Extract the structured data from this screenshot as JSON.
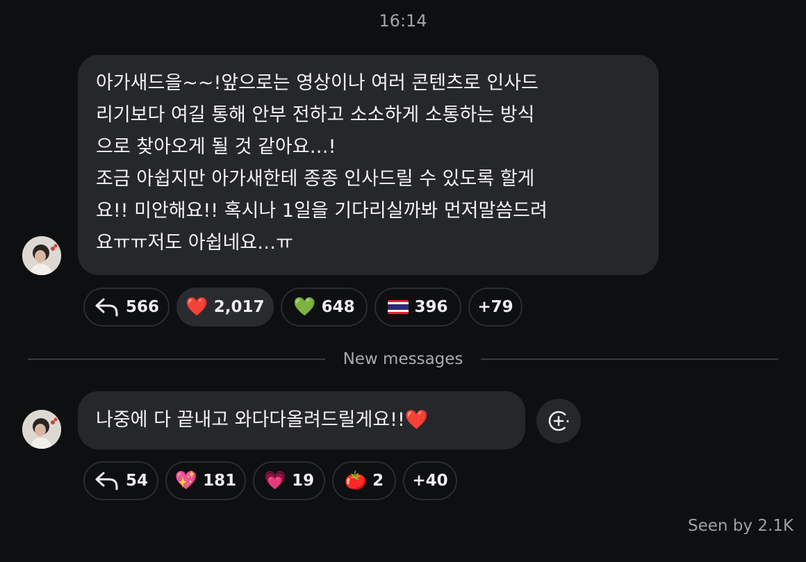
{
  "timestamp": "16:14",
  "messages": [
    {
      "lines": [
        "아가새드을~~!앞으로는 영상이나 여러 콘텐츠로 인사드",
        "리기보다 여길 통해 안부 전하고 소소하게 소통하는 방식",
        "으로 찾아오게 될 것 같아요…!",
        "조금 아쉽지만 아가새한테 종종 인사드릴 수 있도록 할게",
        "요!! 미안해요!! 혹시나 1일을 기다리실까봐 먼저말씀드려",
        "요ㅠㅠ저도 아쉽네요…ㅠ"
      ],
      "reactions": [
        {
          "icon": "reply-icon",
          "count": "566"
        },
        {
          "icon": "❤️",
          "count": "2,017"
        },
        {
          "icon": "💚",
          "count": "648"
        },
        {
          "icon": "thailand-flag-icon",
          "count": "396"
        },
        {
          "more": "+79"
        }
      ]
    },
    {
      "text": "나중에 다 끝내고 와다다올려드릴게요!!",
      "trailing_emoji": "❤️",
      "reactions": [
        {
          "icon": "reply-icon",
          "count": "54"
        },
        {
          "icon": "💖",
          "count": "181"
        },
        {
          "icon": "💗",
          "count": "19"
        },
        {
          "icon": "🍅",
          "count": "2"
        },
        {
          "more": "+40"
        }
      ]
    }
  ],
  "divider_label": "New messages",
  "seen_by": "Seen by 2.1K",
  "colors": {
    "background": "#0e0f11",
    "bubble": "#26272b",
    "muted_text": "#a2a4a8",
    "heart": "#e8242f"
  }
}
